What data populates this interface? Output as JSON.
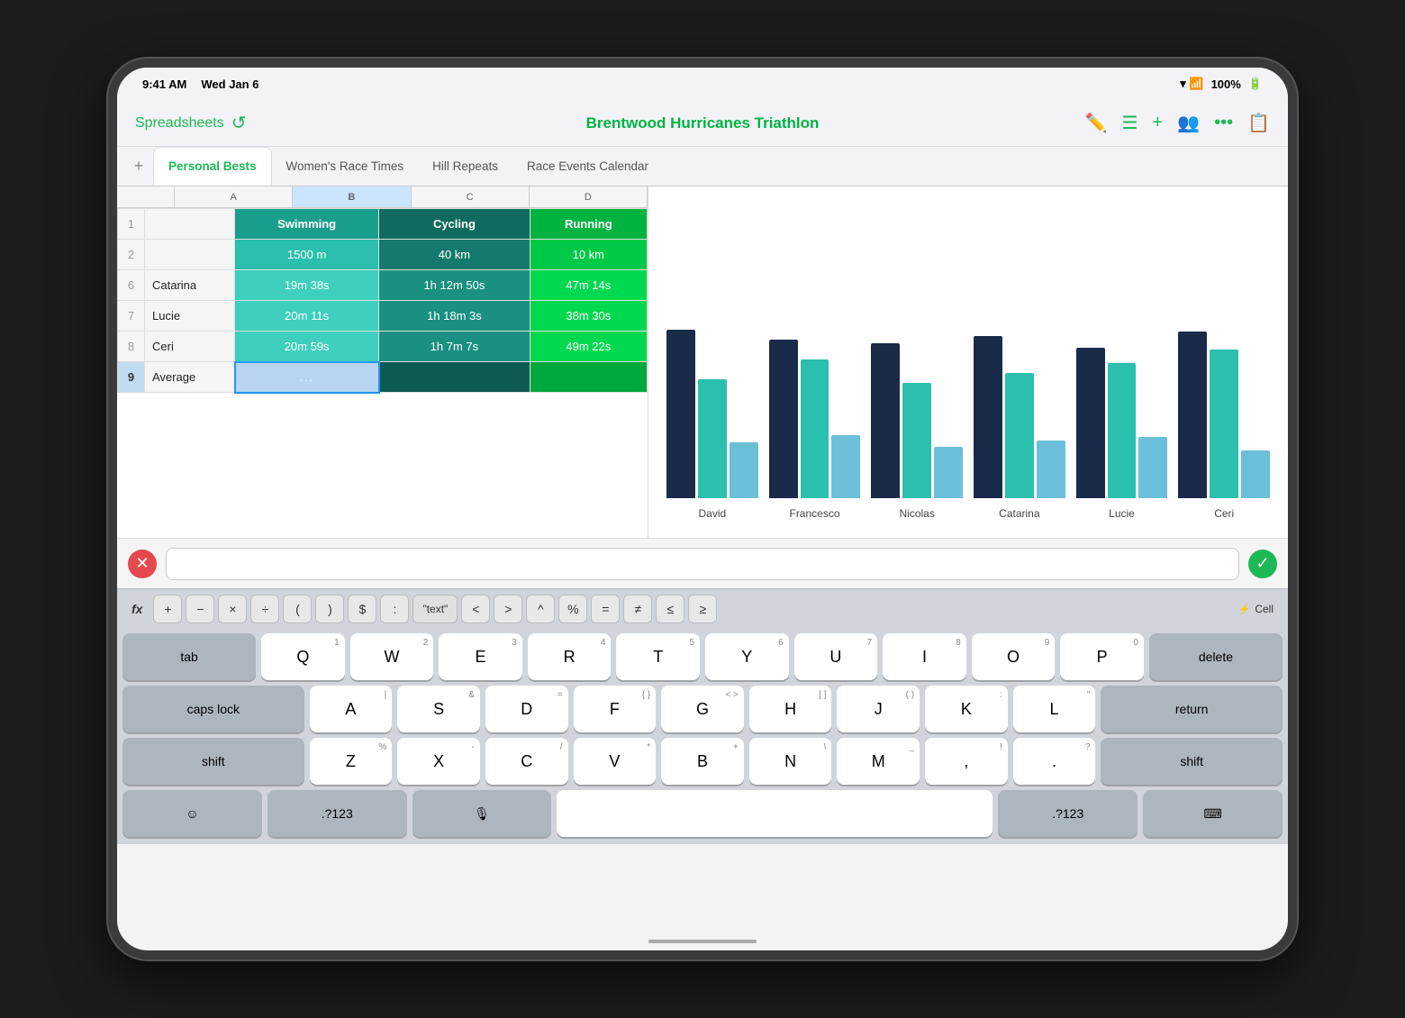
{
  "status": {
    "time": "9:41 AM",
    "day": "Wed Jan 6",
    "battery": "100%"
  },
  "header": {
    "back_label": "Spreadsheets",
    "title": "Brentwood Hurricanes Triathlon"
  },
  "tabs": [
    {
      "label": "Personal Bests",
      "active": true
    },
    {
      "label": "Women's Race Times",
      "active": false
    },
    {
      "label": "Hill Repeats",
      "active": false
    },
    {
      "label": "Race Events Calendar",
      "active": false
    }
  ],
  "columns": {
    "a": "A",
    "b": "B",
    "c": "C",
    "d": "D"
  },
  "spreadsheet": {
    "headers": {
      "swimming": "Swimming",
      "cycling": "Cycling",
      "running": "Running"
    },
    "sub_headers": {
      "swimming": "1500 m",
      "cycling": "40 km",
      "running": "10 km"
    },
    "rows": [
      {
        "row_num": "6",
        "name": "Catarina",
        "swimming": "19m 38s",
        "cycling": "1h 12m 50s",
        "running": "47m 14s"
      },
      {
        "row_num": "7",
        "name": "Lucie",
        "swimming": "20m 11s",
        "cycling": "1h 18m 3s",
        "running": "38m 30s"
      },
      {
        "row_num": "8",
        "name": "Ceri",
        "swimming": "20m 59s",
        "cycling": "1h 7m 7s",
        "running": "49m 22s"
      },
      {
        "row_num": "9",
        "name": "Average",
        "swimming": "...",
        "cycling": "",
        "running": ""
      }
    ]
  },
  "chart": {
    "labels": [
      "David",
      "Francesco",
      "Nicolas",
      "Catarina",
      "Lucie",
      "Ceri"
    ],
    "groups": [
      {
        "dark": 85,
        "teal": 60,
        "light": 28
      },
      {
        "dark": 80,
        "teal": 70,
        "light": 32
      },
      {
        "dark": 78,
        "teal": 58,
        "light": 26
      },
      {
        "dark": 82,
        "teal": 63,
        "light": 29
      },
      {
        "dark": 76,
        "teal": 68,
        "light": 31
      },
      {
        "dark": 84,
        "teal": 75,
        "light": 24
      }
    ]
  },
  "formula_bar": {
    "cancel_icon": "✕",
    "confirm_icon": "✓",
    "input_placeholder": ""
  },
  "keyboard_toolbar": {
    "fx_label": "fx",
    "buttons": [
      "+",
      "−",
      "×",
      "÷",
      "(",
      ")",
      "$",
      ":",
      "\"text\"",
      "<",
      ">",
      "^",
      "%",
      "=",
      "≠",
      "≤",
      "≥"
    ],
    "cell_label": "⚡ Cell"
  },
  "keyboard": {
    "row1": [
      "Q",
      "W",
      "E",
      "R",
      "T",
      "Y",
      "U",
      "I",
      "O",
      "P"
    ],
    "row1_nums": [
      "1",
      "2",
      "3",
      "4",
      "5",
      "6",
      "7",
      "8",
      "9",
      "0"
    ],
    "row2": [
      "A",
      "S",
      "D",
      "F",
      "G",
      "H",
      "J",
      "K",
      "L"
    ],
    "row2_subs": [
      "|",
      "&",
      "=",
      "{  }",
      "<  >",
      "[  ]",
      "(  )",
      ":",
      "”"
    ],
    "row3": [
      "Z",
      "X",
      "C",
      "V",
      "B",
      "N",
      "M",
      ",",
      ".",
      "-"
    ],
    "row3_subs": [
      "%",
      "-",
      "/",
      "*",
      "+",
      "\\",
      "_",
      "!",
      "?",
      ""
    ],
    "special": {
      "tab": "tab",
      "caps_lock": "caps lock",
      "shift": "shift",
      "delete": "delete",
      "return": "return",
      "emoji": "☺",
      "numeric": ".?123",
      "mic": "🎤",
      "space": " ",
      "keyboard_hide": "⌨"
    }
  }
}
